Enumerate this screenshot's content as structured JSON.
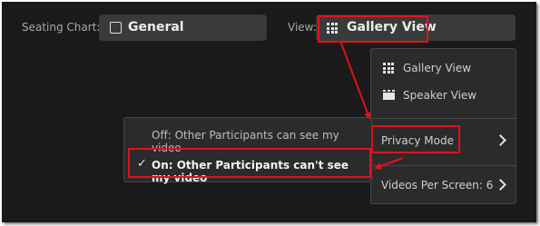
{
  "toolbar": {
    "seating_label": "Seating Chart:",
    "seating_value": "General",
    "view_label": "View:",
    "view_value": "Gallery View"
  },
  "view_menu": {
    "items": [
      {
        "label": "Gallery View",
        "icon": "gallery-grid-icon"
      },
      {
        "label": "Speaker View",
        "icon": "speaker-view-icon"
      },
      {
        "label": "Privacy Mode",
        "icon": "chevron-right-icon"
      },
      {
        "label": "Videos Per Screen: 6",
        "icon": "chevron-right-icon"
      }
    ]
  },
  "privacy_submenu": {
    "items": [
      {
        "label": "Off: Other Participants can see my video",
        "checked": false
      },
      {
        "label": "On: Other Participants can't see my video",
        "checked": true
      }
    ],
    "check_mark": "✓"
  },
  "colors": {
    "background": "#1a1a1a",
    "field": "#3a3a3a",
    "menu": "#2b2b2b",
    "highlight_border": "#e0121b"
  }
}
